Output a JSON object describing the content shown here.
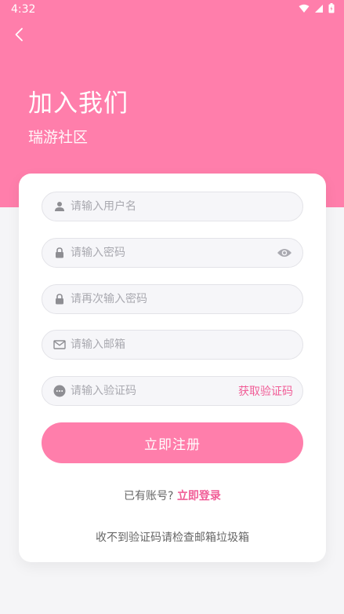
{
  "status_bar": {
    "time": "4:32"
  },
  "header": {
    "title": "加入我们",
    "subtitle": "瑞游社区"
  },
  "form": {
    "username_placeholder": "请输入用户名",
    "password_placeholder": "请输入密码",
    "confirm_password_placeholder": "请再次输入密码",
    "email_placeholder": "请输入邮箱",
    "code_placeholder": "请输入验证码",
    "get_code_label": "获取验证码",
    "submit_label": "立即注册"
  },
  "footer": {
    "have_account": "已有账号?",
    "login_label": "立即登录",
    "tip": "收不到验证码请检查邮箱垃圾箱"
  },
  "colors": {
    "accent": "#ff7eab",
    "link": "#f15d97",
    "background": "#f5f5f7",
    "icon": "#8e8e93"
  }
}
